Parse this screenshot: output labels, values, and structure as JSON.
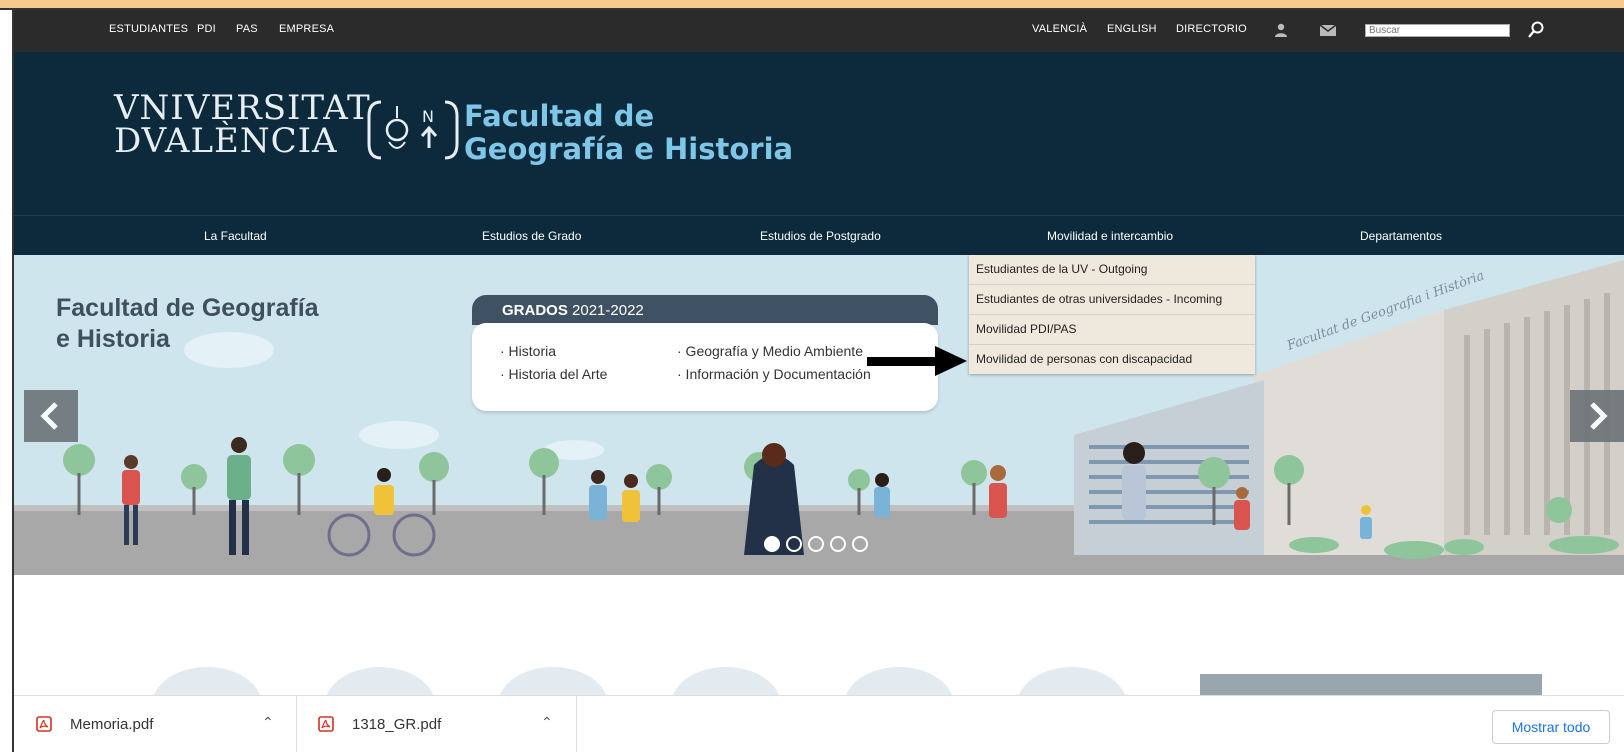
{
  "topbar": {
    "links_left": [
      "ESTUDIANTES",
      "PDI",
      "PAS",
      "EMPRESA"
    ],
    "links_right": [
      "VALENCIÀ",
      "ENGLISH",
      "DIRECTORIO"
    ],
    "search_placeholder": "Buscar"
  },
  "header": {
    "uv_logo_line1": "VNIVERSITAT",
    "uv_logo_line2": "DVALÈNCIA",
    "faculty_line1": "Facultad de",
    "faculty_line2": "Geografía e Historia"
  },
  "nav": {
    "items": [
      "La Facultad",
      "Estudios de Grado",
      "Estudios de Postgrado",
      "Movilidad e intercambio",
      "Departamentos"
    ]
  },
  "dropdown": {
    "items": [
      "Estudiantes de la UV - Outgoing",
      "Estudiantes de otras universidades - Incoming",
      "Movilidad PDI/PAS",
      "Movilidad de personas con discapacidad"
    ]
  },
  "hero": {
    "title_line1": "Facultad de Geografía",
    "title_line2": "e Historia",
    "grados_label": "GRADOS",
    "grados_year": "2021-2022",
    "grados": [
      "· Historia",
      "· Historia del Arte",
      "· Geografía y Medio Ambiente",
      "· Información y Documentación"
    ],
    "building_text": "Facultat de Geografia i Història",
    "slide_count": 5,
    "active_slide": 1
  },
  "downloads": {
    "files": [
      "Memoria.pdf",
      "1318_GR.pdf"
    ],
    "show_all": "Mostrar todo"
  },
  "colors": {
    "topbar": "#2b2b2b",
    "header": "#0c2a3c",
    "faculty_accent": "#7fc7e8",
    "dropdown": "#efe8dc",
    "hero_sky": "#cfe5ee"
  }
}
